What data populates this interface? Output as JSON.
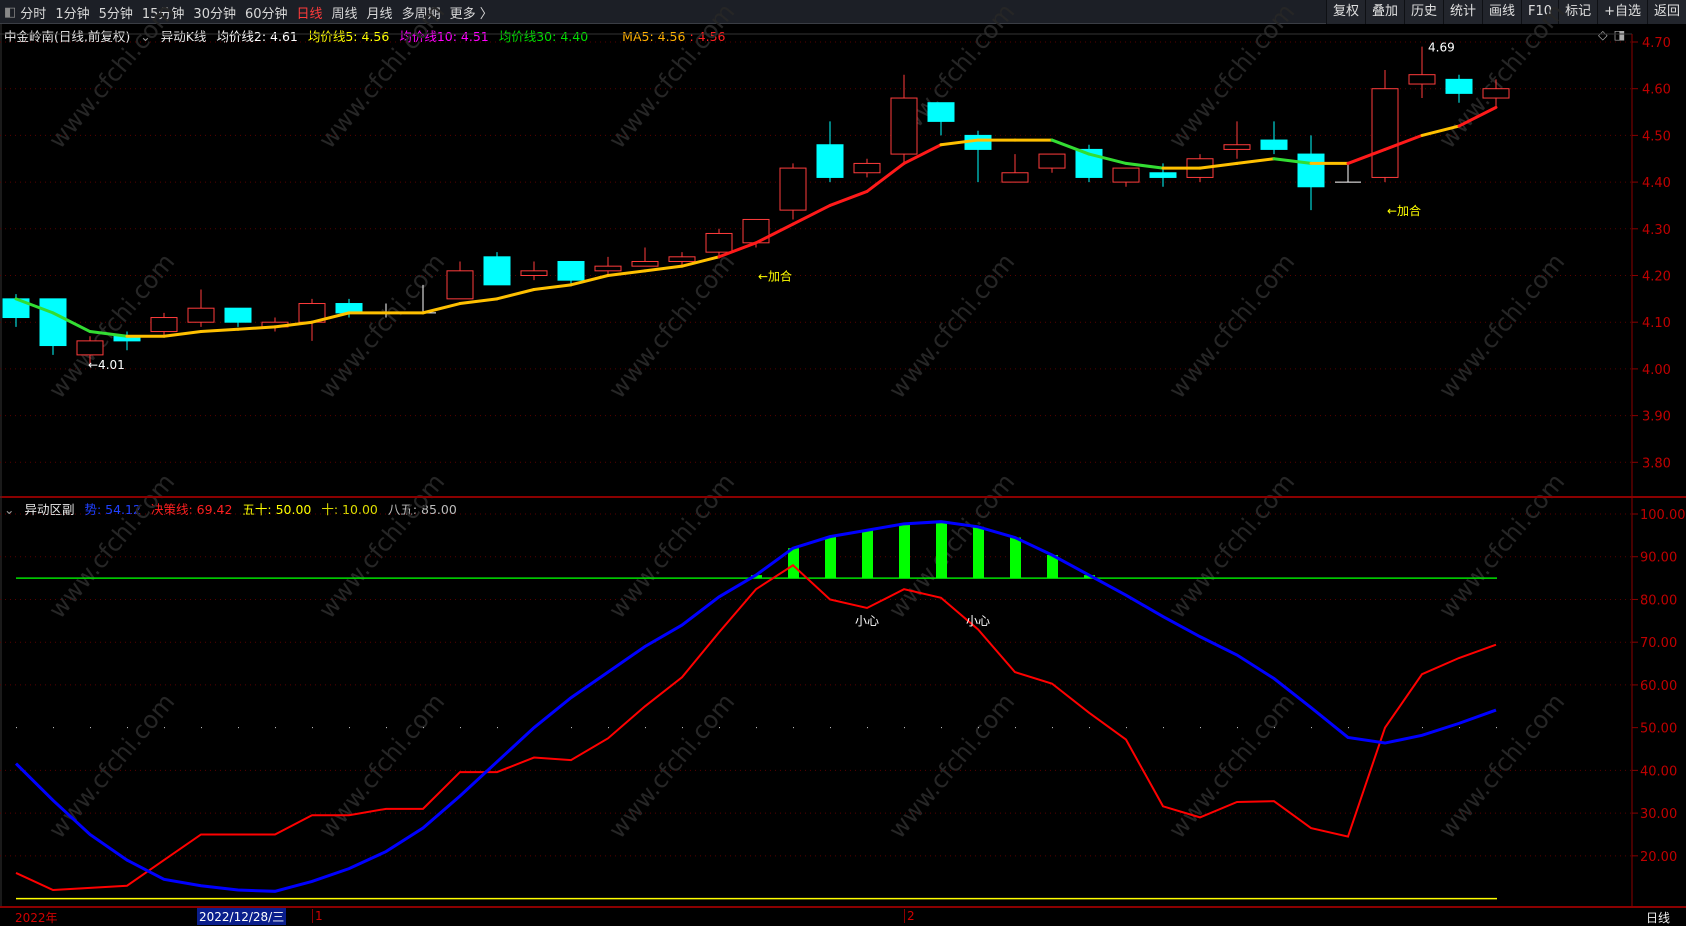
{
  "toolbar": {
    "periods": [
      "分时",
      "1分钟",
      "5分钟",
      "15分钟",
      "30分钟",
      "60分钟",
      "日线",
      "周线",
      "月线",
      "多周期",
      "更多 〉"
    ],
    "active_period": "日线",
    "actions": [
      "复权",
      "叠加",
      "历史",
      "统计",
      "画线",
      "F10",
      "标记",
      "+自选",
      "返回"
    ]
  },
  "main_header": {
    "stock": "中金岭南(日线,前复权)",
    "indicator": "异动K线",
    "ma2": "均价线2: 4.61",
    "ma5": "均价线5: 4.56",
    "ma10": "均价线10: 4.51",
    "ma30": "均价线30: 4.40",
    "ma5_label": "MA5: 4.56",
    "ma5_red": ": 4.56"
  },
  "sub_header": {
    "name": "异动区副",
    "trend": "势: 54.12",
    "decision": "决策线: 69.42",
    "fifty": "五十: 50.00",
    "ten": "十: 10.00",
    "eightyfive": "八五: 85.00"
  },
  "price_axis": [
    "4.70",
    "4.60",
    "4.50",
    "4.40",
    "4.30",
    "4.20",
    "4.10",
    "4.00",
    "3.90",
    "3.80"
  ],
  "osc_axis": [
    "100.00",
    "90.00",
    "80.00",
    "70.00",
    "60.00",
    "50.00",
    "40.00",
    "30.00",
    "20.00"
  ],
  "annotations": {
    "low_label": "←4.01",
    "high_label": "4.69",
    "signal1": "←加合",
    "signal2": "←加合",
    "caution1": "小心",
    "caution2": "小心"
  },
  "bottom": {
    "year": "2022年",
    "cursor_date": "2022/12/28/三",
    "month1": "1",
    "month2": "2",
    "period": "日线"
  },
  "watermark": "www.cfchi.com",
  "colors": {
    "up": "#ff3c3c",
    "down": "#00ffff",
    "trend": "#0000ff",
    "decision": "#ff0000",
    "bars": "#00ff00",
    "line85": "#00e000",
    "line10": "#ffff00"
  },
  "chart_data": {
    "type": "candlestick",
    "candles": [
      [
        4.15,
        4.11,
        4.16,
        4.09
      ],
      [
        4.15,
        4.05,
        4.15,
        4.03
      ],
      [
        4.03,
        4.06,
        4.07,
        4.01
      ],
      [
        4.07,
        4.06,
        4.08,
        4.04
      ],
      [
        4.08,
        4.11,
        4.12,
        4.07
      ],
      [
        4.1,
        4.13,
        4.17,
        4.09
      ],
      [
        4.13,
        4.1,
        4.13,
        4.09
      ],
      [
        4.09,
        4.1,
        4.11,
        4.08
      ],
      [
        4.1,
        4.14,
        4.15,
        4.06
      ],
      [
        4.14,
        4.12,
        4.15,
        4.11
      ],
      [
        4.12,
        4.12,
        4.14,
        4.11
      ],
      [
        4.12,
        4.12,
        4.18,
        4.12
      ],
      [
        4.15,
        4.21,
        4.23,
        4.15
      ],
      [
        4.24,
        4.18,
        4.25,
        4.18
      ],
      [
        4.2,
        4.21,
        4.23,
        4.19
      ],
      [
        4.23,
        4.19,
        4.23,
        4.18
      ],
      [
        4.21,
        4.22,
        4.24,
        4.2
      ],
      [
        4.22,
        4.23,
        4.26,
        4.22
      ],
      [
        4.23,
        4.24,
        4.25,
        4.22
      ],
      [
        4.25,
        4.29,
        4.3,
        4.24
      ],
      [
        4.27,
        4.32,
        4.32,
        4.26
      ],
      [
        4.34,
        4.43,
        4.44,
        4.32
      ],
      [
        4.48,
        4.41,
        4.53,
        4.4
      ],
      [
        4.42,
        4.44,
        4.45,
        4.41
      ],
      [
        4.46,
        4.58,
        4.63,
        4.44
      ],
      [
        4.57,
        4.53,
        4.57,
        4.5
      ],
      [
        4.5,
        4.47,
        4.51,
        4.4
      ],
      [
        4.4,
        4.42,
        4.46,
        4.4
      ],
      [
        4.43,
        4.46,
        4.46,
        4.42
      ],
      [
        4.47,
        4.41,
        4.48,
        4.4
      ],
      [
        4.4,
        4.43,
        4.43,
        4.39
      ],
      [
        4.42,
        4.41,
        4.44,
        4.39
      ],
      [
        4.41,
        4.45,
        4.46,
        4.4
      ],
      [
        4.47,
        4.48,
        4.53,
        4.45
      ],
      [
        4.49,
        4.47,
        4.53,
        4.46
      ],
      [
        4.46,
        4.39,
        4.5,
        4.34
      ],
      [
        4.4,
        4.4,
        4.44,
        4.4
      ],
      [
        4.41,
        4.6,
        4.64,
        4.4
      ],
      [
        4.61,
        4.63,
        4.69,
        4.58
      ],
      [
        4.62,
        4.59,
        4.63,
        4.57
      ],
      [
        4.58,
        4.6,
        4.62,
        4.56
      ]
    ],
    "ma": [
      4.15,
      4.12,
      4.08,
      4.07,
      4.07,
      4.08,
      4.085,
      4.09,
      4.1,
      4.12,
      4.12,
      4.12,
      4.14,
      4.15,
      4.17,
      4.18,
      4.2,
      4.21,
      4.22,
      4.24,
      4.27,
      4.31,
      4.35,
      4.38,
      4.44,
      4.48,
      4.49,
      4.49,
      4.49,
      4.46,
      4.44,
      4.43,
      4.43,
      4.44,
      4.45,
      4.44,
      4.44,
      4.47,
      4.5,
      4.52,
      4.56
    ],
    "price_range": [
      3.75,
      4.72
    ],
    "trend": [
      41.6,
      33,
      25,
      19,
      14.5,
      13,
      12,
      11.7,
      14,
      17,
      21,
      26.5,
      34,
      42,
      50,
      57,
      63,
      69,
      74,
      80.6,
      85.7,
      92,
      94.7,
      96.2,
      97.7,
      98.2,
      97,
      94.5,
      90.4,
      85.7,
      81,
      76,
      71.3,
      67,
      61.5,
      54.7,
      47.7,
      46.4,
      48.2,
      51,
      54.12
    ],
    "decision": [
      16,
      12,
      12.5,
      13,
      19,
      25,
      25,
      25,
      29.5,
      29.5,
      31,
      31,
      39.6,
      39.6,
      43,
      42.4,
      47.5,
      55,
      61.8,
      72.3,
      82.4,
      88,
      80,
      78,
      82.4,
      80.4,
      73,
      63,
      60.3,
      53.5,
      47.2,
      31.6,
      29,
      32.6,
      32.8,
      26.5,
      24.5,
      50,
      62.5,
      66.3,
      69.42
    ],
    "levels": {
      "fifty": 50,
      "ten": 10,
      "eightyfive": 85
    },
    "osc_range": [
      7,
      102
    ]
  }
}
